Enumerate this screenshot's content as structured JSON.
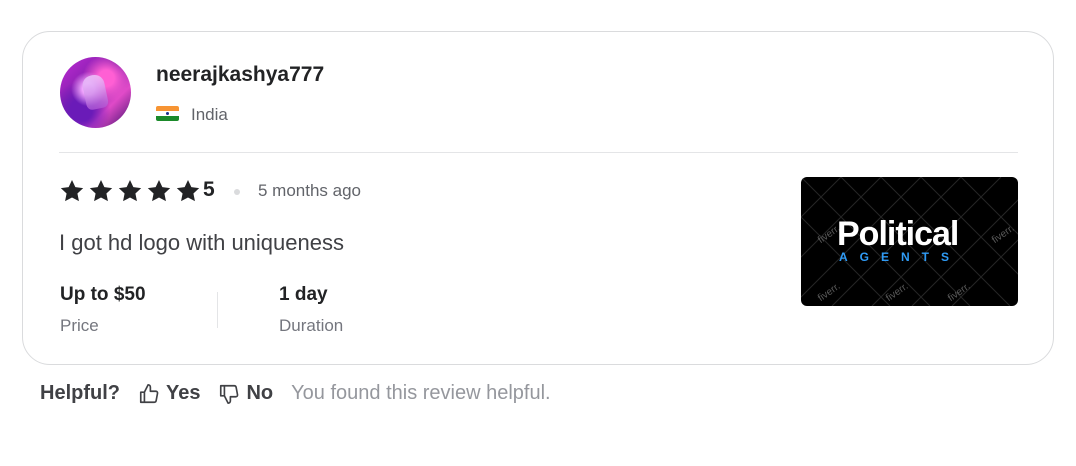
{
  "reviewer": {
    "username": "neerajkashya777",
    "country": "India",
    "avatar_icon": "user-avatar-photo",
    "flag_icon": "india-flag-icon"
  },
  "review": {
    "stars": 5,
    "rating_text": "5",
    "time_ago": "5 months ago",
    "text": "I got hd logo with uniqueness",
    "star_color": "#222325"
  },
  "meta": {
    "price_value": "Up to $50",
    "price_label": "Price",
    "duration_value": "1 day",
    "duration_label": "Duration"
  },
  "thumbnail": {
    "title": "Political",
    "subtitle": "AGENTS",
    "watermark": "fiverr.",
    "accent": "#2f9bf5"
  },
  "helpful": {
    "question": "Helpful?",
    "yes_label": "Yes",
    "no_label": "No",
    "status": "You found this review helpful."
  }
}
